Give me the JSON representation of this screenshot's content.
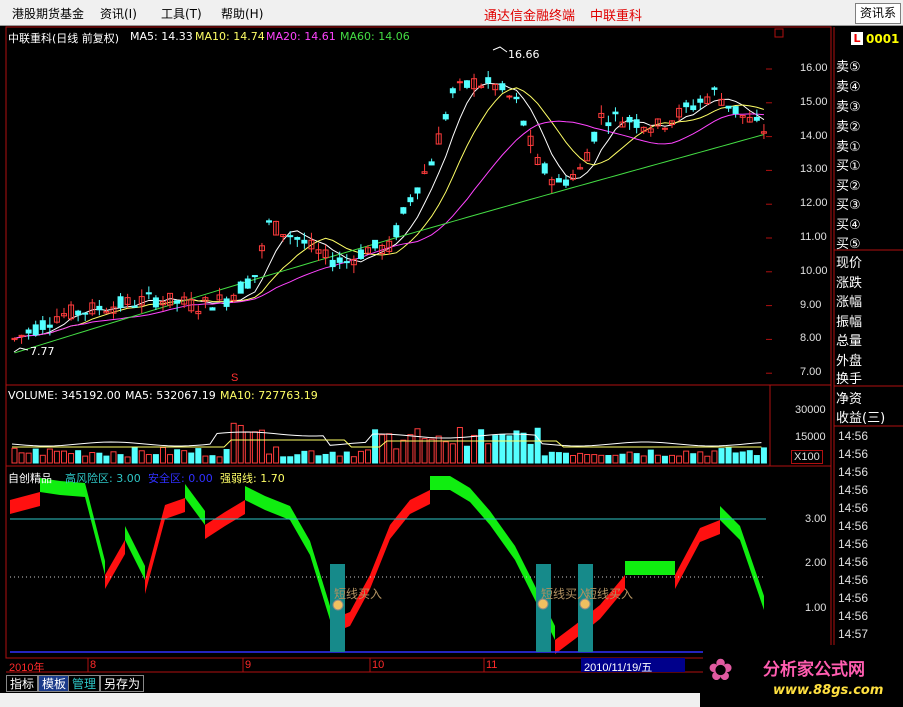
{
  "menubar": {
    "items": [
      "港股期货基金",
      "资讯(I)",
      "工具(T)",
      "帮助(H)"
    ],
    "title_left": "通达信金融终端",
    "title_right": "中联重科",
    "search_button": "资讯系"
  },
  "colors": {
    "up": "#ff3c3c",
    "down": "#54ffff",
    "ma5": "#ffffff",
    "ma10": "#ffff66",
    "ma20": "#ff44ff",
    "ma60": "#44dd44",
    "teal": "#158c8c"
  },
  "kline": {
    "header": "中联重科(日线 前复权)",
    "ma5": "MA5: 14.33",
    "ma10": "MA10: 14.74",
    "ma20": "MA20: 14.61",
    "ma60": "MA60: 14.06",
    "high_label": "16.66",
    "low_label": "7.77",
    "axis_ticks": [
      "16.00",
      "15.00",
      "14.00",
      "13.00",
      "12.00",
      "11.00",
      "10.00",
      "9.00",
      "8.00",
      "7.00"
    ],
    "marker": "S"
  },
  "volume": {
    "header": "VOLUME: 345192.00",
    "ma5": "MA5: 532067.19",
    "ma10": "MA10: 727763.19",
    "axis_ticks": [
      "30000",
      "15000"
    ],
    "unit": "X100"
  },
  "indicator": {
    "name": "自创精品",
    "high_risk": "高风险区: 3.00",
    "safe": "安全区: 0.00",
    "strength": "强弱线: 1.70",
    "axis_ticks": [
      "3.00",
      "2.00",
      "1.00"
    ],
    "signals": [
      "短线买入",
      "短线买入",
      "短线买入"
    ]
  },
  "dates": {
    "year": "2010年",
    "months": [
      "8",
      "9",
      "10",
      "11"
    ],
    "cursor": "2010/11/19/五"
  },
  "quote_panel": {
    "code": "0001",
    "sell": [
      "卖⑤",
      "卖④",
      "卖③",
      "卖②",
      "卖①"
    ],
    "buy": [
      "买①",
      "买②",
      "买③",
      "买④",
      "买⑤"
    ],
    "stats": [
      "现价",
      "涨跌",
      "涨幅",
      "振幅",
      "总量",
      "外盘"
    ],
    "stats2": [
      "换手",
      "净资",
      "收益(三)"
    ],
    "times": [
      "14:56",
      "14:56",
      "14:56",
      "14:56",
      "14:56",
      "14:56",
      "14:56",
      "14:56",
      "14:56",
      "14:56",
      "14:56",
      "14:57",
      "14:56"
    ]
  },
  "bottom_tabs": [
    "指标",
    "模板",
    "管理",
    "另存为"
  ],
  "watermark": {
    "name": "分析家公式网",
    "url": "www.88gs.com"
  }
}
